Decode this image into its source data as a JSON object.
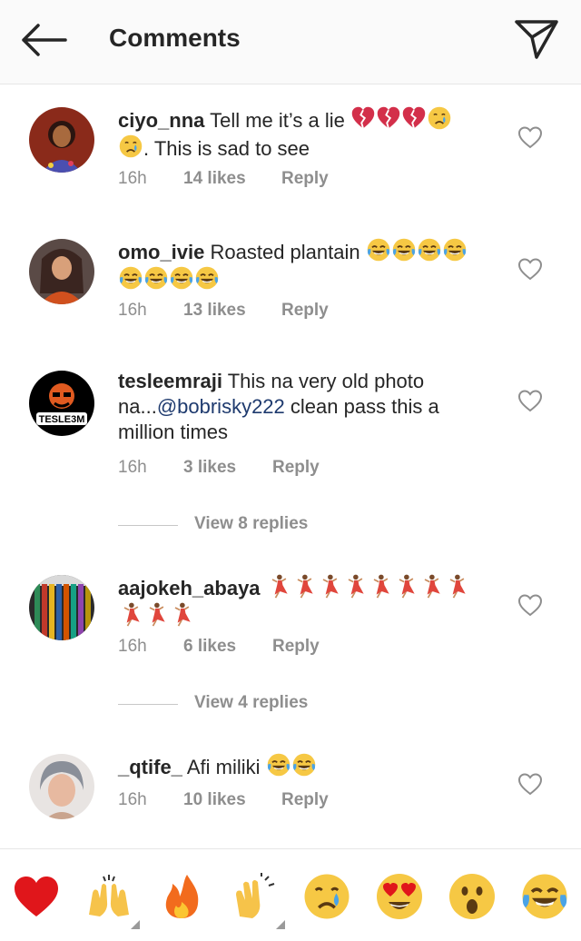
{
  "header": {
    "title": "Comments",
    "back_icon": "arrow-left-icon",
    "send_icon": "paper-plane-icon"
  },
  "comments": [
    {
      "username": "ciyo_nna",
      "text": "Tell me it’s a lie",
      "text_after": ". This is sad to see",
      "time": "16h",
      "likes": "14 likes",
      "reply": "Reply"
    },
    {
      "username": "omo_ivie",
      "text": "Roasted plantain",
      "time": "16h",
      "likes": "13 likes",
      "reply": "Reply"
    },
    {
      "username": "tesleemraji",
      "text": "This na very old photo na...",
      "mention": "@bobrisky222",
      "text_after": " clean pass this a million times",
      "time": "16h",
      "likes": "3 likes",
      "reply": "Reply",
      "view_replies": "View 8 replies",
      "avatar_text": "TESLE3M"
    },
    {
      "username": "aajokeh_abaya",
      "text": "",
      "time": "16h",
      "likes": "6 likes",
      "reply": "Reply",
      "view_replies": "View 4 replies"
    },
    {
      "username": "_qtife_",
      "text": "Afi miliki",
      "time": "16h",
      "likes": "10 likes",
      "reply": "Reply"
    }
  ],
  "reactions": [
    "red-heart",
    "raising-hands",
    "fire",
    "clapping-hands",
    "crying-face",
    "heart-eyes-face",
    "surprised-face",
    "tears-of-joy-face"
  ],
  "colors": {
    "header_bg": "#fafafa",
    "meta": "#8e8e8e",
    "mention": "#1e3a6e",
    "text": "#262626"
  }
}
